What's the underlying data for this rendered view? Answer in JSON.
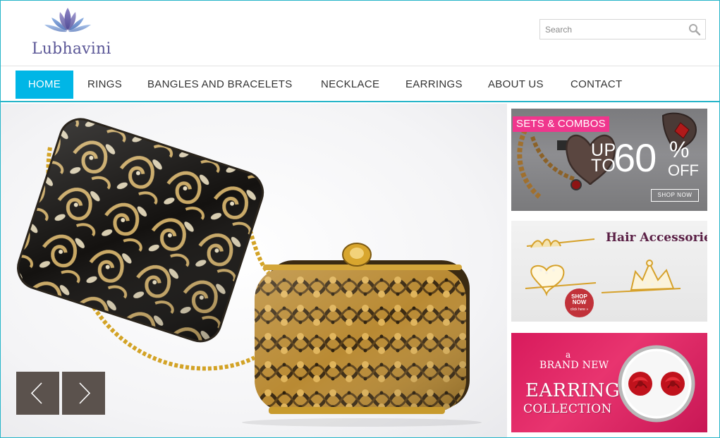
{
  "brand": {
    "name": "Lubhavini"
  },
  "search": {
    "placeholder": "Search"
  },
  "nav": {
    "items": [
      {
        "label": "HOME",
        "active": true
      },
      {
        "label": "RINGS"
      },
      {
        "label": "BANGLES AND BRACELETS"
      },
      {
        "label": "NECKLACE"
      },
      {
        "label": "EARRINGS"
      },
      {
        "label": "ABOUT US"
      },
      {
        "label": "CONTACT"
      }
    ]
  },
  "slider": {
    "prev_icon": "chevron-left-icon",
    "next_icon": "chevron-right-icon"
  },
  "promos": {
    "sets": {
      "tag": "SETS & COMBOS",
      "line1": "UP",
      "line2": "TO",
      "amount": "60",
      "percent": "%",
      "off": "OFF",
      "cta": "SHOP NOW"
    },
    "hair": {
      "title": "Hair Accessories",
      "cta_line1": "SHOP",
      "cta_line2": "NOW",
      "cta_small": "click here »"
    },
    "earring": {
      "line_a": "a",
      "line_brand": "BRAND NEW",
      "line_main": "EARRING",
      "line_coll": "COLLECTION"
    }
  },
  "colors": {
    "accent": "#26b5c9",
    "active_nav": "#00b6e6",
    "pink_tag": "#f0368d",
    "logo_purple": "#5b5797",
    "arrow_bg": "#5b524d",
    "earring_bg": "#d81a5c"
  }
}
